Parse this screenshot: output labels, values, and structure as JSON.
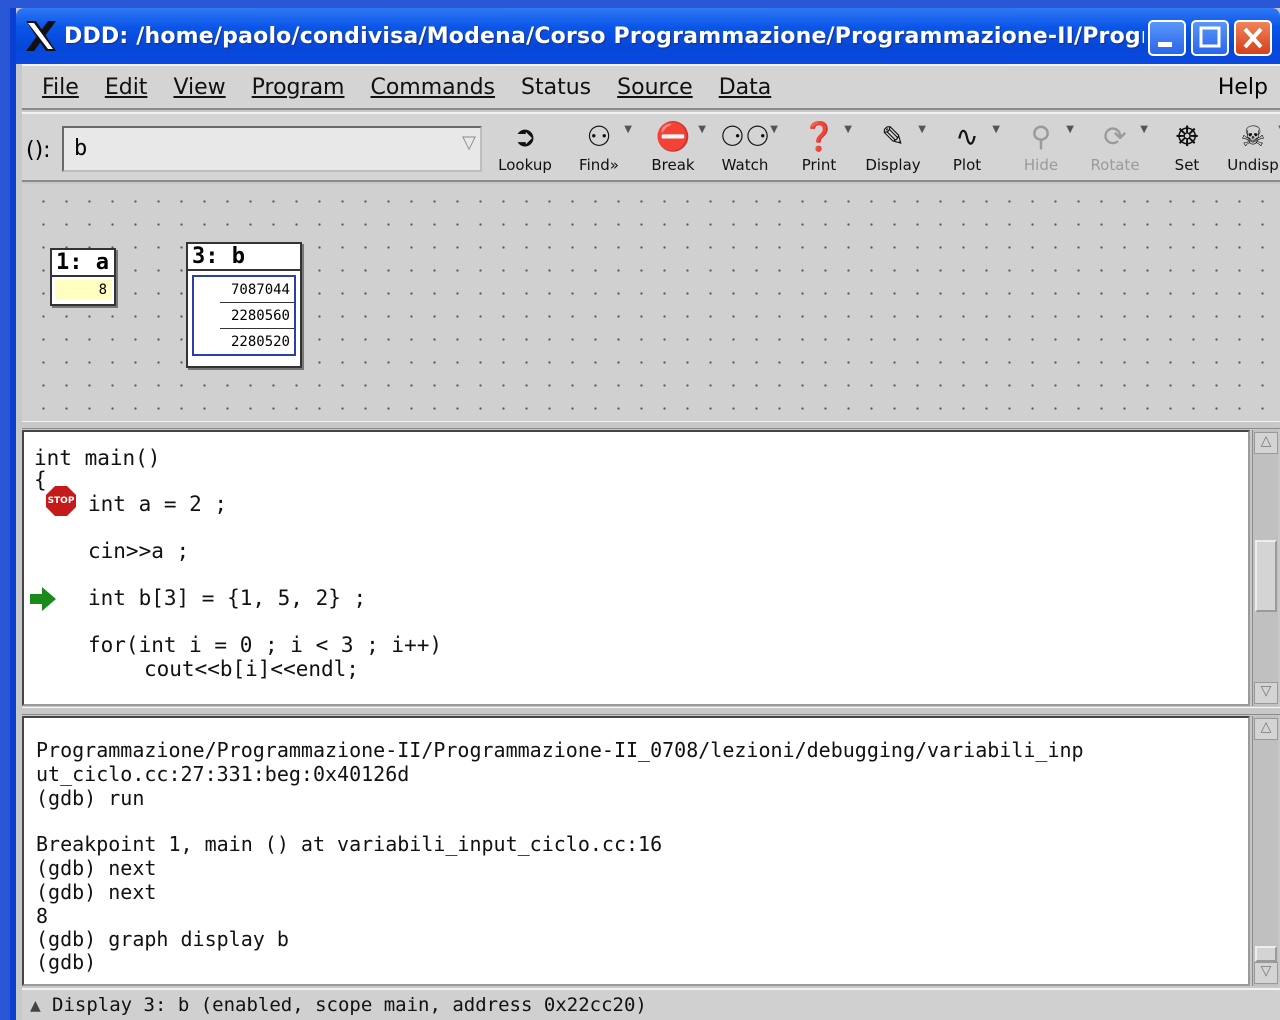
{
  "window": {
    "title": "DDD: /home/paolo/condivisa/Modena/Corso Programmazione/Programmazione-II/Progr..."
  },
  "menu": {
    "file": "File",
    "edit": "Edit",
    "view": "View",
    "program": "Program",
    "commands": "Commands",
    "status": "Status",
    "source": "Source",
    "data": "Data",
    "help": "Help"
  },
  "toolbar": {
    "arg_label": "():",
    "arg_value": "b",
    "tools": {
      "lookup": "Lookup",
      "find": "Find»",
      "break": "Break",
      "watch": "Watch",
      "print": "Print",
      "display": "Display",
      "plot": "Plot",
      "hide": "Hide",
      "rotate": "Rotate",
      "set": "Set",
      "undisp": "Undisp"
    }
  },
  "data_displays": {
    "a": {
      "header": "1: a",
      "value": "8"
    },
    "b": {
      "header": "3: b",
      "values": [
        "7087044",
        "2280560",
        "2280520"
      ]
    }
  },
  "source": {
    "lines": [
      "int main()",
      "{",
      "int a = 2 ;",
      "cin>>a ;",
      "int b[3] = {1, 5, 2} ;",
      "for(int i = 0 ; i < 3 ; i++)",
      "cout<<b[i]<<endl;"
    ],
    "stop_label": "STOP"
  },
  "console": {
    "lines": [
      "Programmazione/Programmazione-II/Programmazione-II_0708/lezioni/debugging/variabili_inp",
      "ut_ciclo.cc:27:331:beg:0x40126d",
      "(gdb) run",
      "",
      "Breakpoint 1, main () at variabili_input_ciclo.cc:16",
      "(gdb) next",
      "(gdb) next",
      "8",
      "(gdb) graph display b",
      "(gdb)"
    ]
  },
  "status": {
    "text": "Display 3: b (enabled, scope main, address 0x22cc20)"
  },
  "colors": {
    "titlebar": "#0a55e8",
    "stop": "#c41a1a",
    "exec_arrow": "#1a8a1a",
    "value_bg": "#ffffbf"
  }
}
